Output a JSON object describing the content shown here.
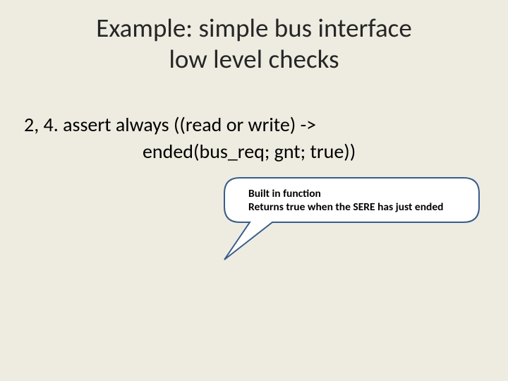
{
  "title": {
    "line1": "Example: simple bus interface",
    "line2": "low level checks"
  },
  "body": {
    "line1": "2, 4. assert  always ((read or write) ->",
    "line2": "ended(bus_req;  gnt;  true))"
  },
  "callout": {
    "line1": "Built in function",
    "line2": "Returns true when the SERE has just ended"
  },
  "colors": {
    "background": "#eeece1",
    "callout_stroke": "#385d8a",
    "callout_fill": "#ffffff"
  }
}
